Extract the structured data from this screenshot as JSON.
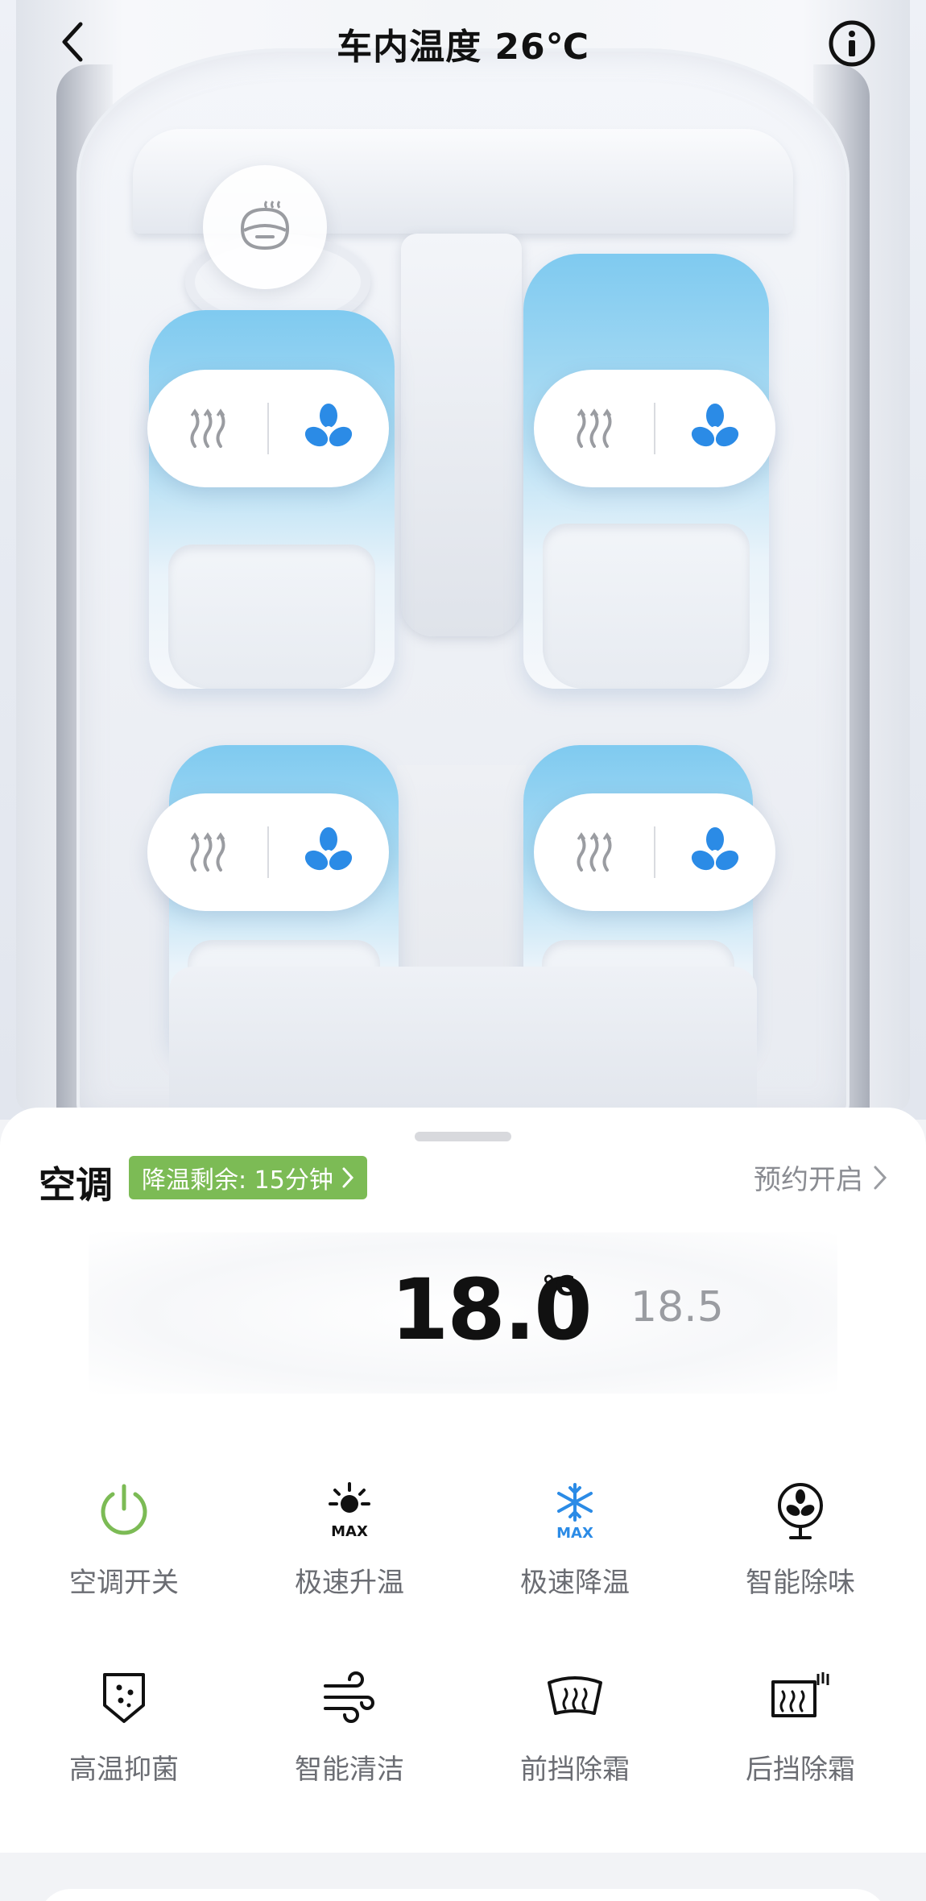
{
  "header": {
    "title": "车内温度 26℃",
    "back_icon": "chevron-left-icon",
    "info_icon": "info-circle-icon"
  },
  "car_view": {
    "steering_defrost_icon": "steering-wheel-heat-icon",
    "seats": [
      {
        "id": "front-left",
        "heat_icon": "seat-heat-icon",
        "vent_icon": "fan-icon"
      },
      {
        "id": "front-right",
        "heat_icon": "seat-heat-icon",
        "vent_icon": "fan-icon"
      },
      {
        "id": "rear-left",
        "heat_icon": "seat-heat-icon",
        "vent_icon": "fan-icon"
      },
      {
        "id": "rear-right",
        "heat_icon": "seat-heat-icon",
        "vent_icon": "fan-icon"
      }
    ],
    "fan_color": "#2b8be6",
    "heat_color": "#9a9ca1"
  },
  "ac": {
    "title": "空调",
    "countdown": "降温剩余: 15分钟",
    "schedule": "预约开启",
    "target_temp": "18.0",
    "unit": "℃",
    "next_temp": "18.5",
    "badge_color": "#7cbb55"
  },
  "functions": [
    {
      "label": "空调开关",
      "icon": "power-icon",
      "color": "#7cbb55"
    },
    {
      "label": "极速升温",
      "icon": "sun-max-icon",
      "color": "#111111"
    },
    {
      "label": "极速降温",
      "icon": "snowflake-max-icon",
      "color": "#2b8be6"
    },
    {
      "label": "智能除味",
      "icon": "deodorize-fan-icon",
      "color": "#111111"
    },
    {
      "label": "高温抑菌",
      "icon": "sterilize-shield-icon",
      "color": "#111111"
    },
    {
      "label": "智能清洁",
      "icon": "wind-clean-icon",
      "color": "#111111"
    },
    {
      "label": "前挡除霜",
      "icon": "front-defrost-icon",
      "color": "#111111"
    },
    {
      "label": "后挡除霜",
      "icon": "rear-defrost-icon",
      "color": "#111111"
    }
  ]
}
